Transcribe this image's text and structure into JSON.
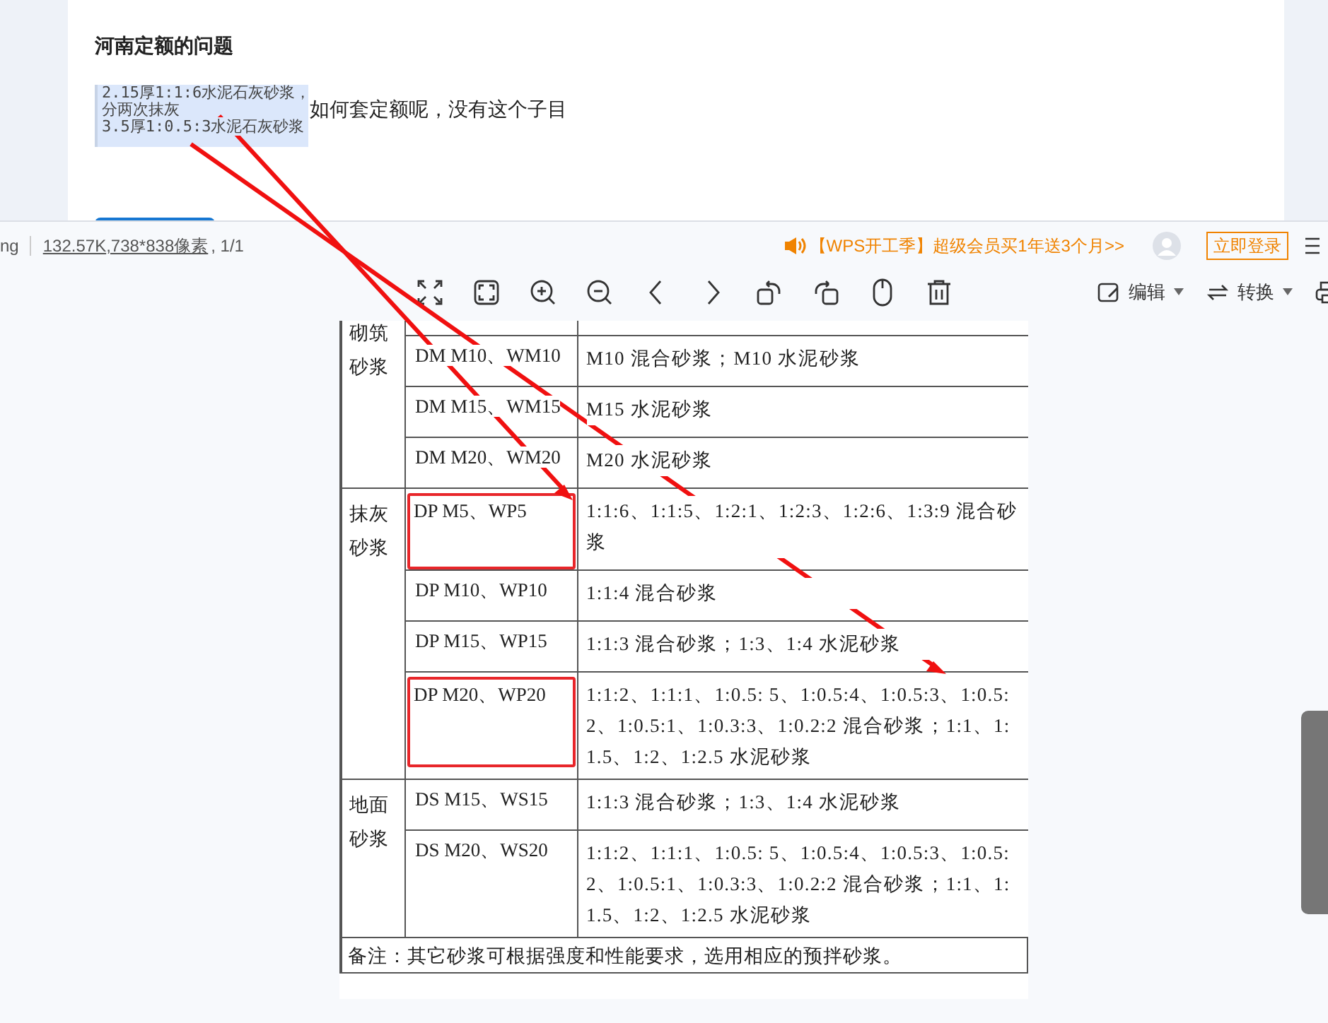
{
  "post": {
    "title": "河南定额的问题",
    "quote_lines": [
      "2.15厚1:1:6水泥石灰砂浆，",
      "分两次抹灰",
      "3.5厚1:0.5:3水泥石灰砂浆"
    ],
    "question": "如何套定额呢，没有这个子目"
  },
  "viewer": {
    "file_tail": "ng",
    "size": "132.57K",
    "dimensions": ",738*838像素",
    "page": ", 1/1",
    "promo": "【WPS开工季】超级会员买1年送3个月>>",
    "login": "立即登录",
    "edit": "编辑",
    "convert": "转换"
  },
  "table": {
    "groups": [
      {
        "category": "砌筑砂浆",
        "rows": [
          {
            "code": "",
            "desc": "",
            "boxed": false
          },
          {
            "code": "DM M10、WM10",
            "desc": "M10 混合砂浆；M10 水泥砂浆",
            "boxed": false
          },
          {
            "code": "DM M15、WM15",
            "desc": "M15 水泥砂浆",
            "boxed": false
          },
          {
            "code": "DM M20、WM20",
            "desc": "M20 水泥砂浆",
            "boxed": false
          }
        ]
      },
      {
        "category": "抹灰砂浆",
        "rows": [
          {
            "code": "DP M5、WP5",
            "desc": "1:1:6、1:1:5、1:2:1、1:2:3、1:2:6、1:3:9 混合砂浆",
            "boxed": true
          },
          {
            "code": "DP M10、WP10",
            "desc": "1:1:4 混合砂浆",
            "boxed": false
          },
          {
            "code": "DP M15、WP15",
            "desc": "1:1:3 混合砂浆；1:3、1:4 水泥砂浆",
            "boxed": false
          },
          {
            "code": "DP M20、WP20",
            "desc": "1:1:2、1:1:1、1:0.5: 5、1:0.5:4、1:0.5:3、1:0.5:2、1:0.5:1、1:0.3:3、1:0.2:2 混合砂浆；1:1、1:1.5、1:2、1:2.5 水泥砂浆",
            "boxed": true
          }
        ]
      },
      {
        "category": "地面砂浆",
        "rows": [
          {
            "code": "DS M15、WS15",
            "desc": "1:1:3 混合砂浆；1:3、1:4 水泥砂浆",
            "boxed": false
          },
          {
            "code": "DS M20、WS20",
            "desc": "1:1:2、1:1:1、1:0.5: 5、1:0.5:4、1:0.5:3、1:0.5:2、1:0.5:1、1:0.3:3、1:0.2:2 混合砂浆；1:1、1:1.5、1:2、1:2.5 水泥砂浆",
            "boxed": false
          }
        ]
      }
    ],
    "note": "备注：其它砂浆可根据强度和性能要求，选用相应的预拌砂浆。"
  }
}
